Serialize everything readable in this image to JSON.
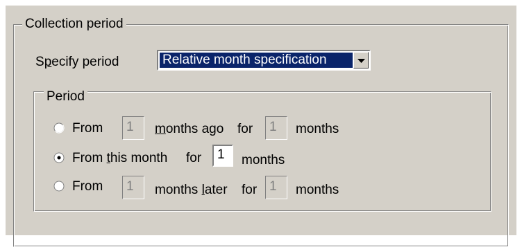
{
  "collection_period": {
    "legend": "Collection period",
    "specify_period": {
      "label_before": "S",
      "label_underlined": "p",
      "label_after": "ecify period",
      "selected_value": "Relative month specification"
    },
    "period": {
      "legend": "Period",
      "rows": [
        {
          "selected": false,
          "from_label": "From",
          "field1_value": "1",
          "middle_underlined": "m",
          "middle_after": "onths ago",
          "for_label": "for",
          "field2_value": "1",
          "end_label": "months"
        },
        {
          "selected": true,
          "from_label": "From",
          "this_underlined": "t",
          "this_after": "his month",
          "for_label": "for",
          "field_value": "1",
          "end_label": "months"
        },
        {
          "selected": false,
          "from_label": "From",
          "field1_value": "1",
          "middle_before": "months ",
          "middle_underlined": "l",
          "middle_after": "ater",
          "for_label": "for",
          "field2_value": "1",
          "end_label": "months"
        }
      ]
    }
  },
  "icons": [
    "dropdown-arrow-icon",
    "radio-unchecked-icon",
    "radio-checked-icon"
  ],
  "colors": {
    "panel": "#d4d0c8",
    "selection": "#0a246a"
  }
}
